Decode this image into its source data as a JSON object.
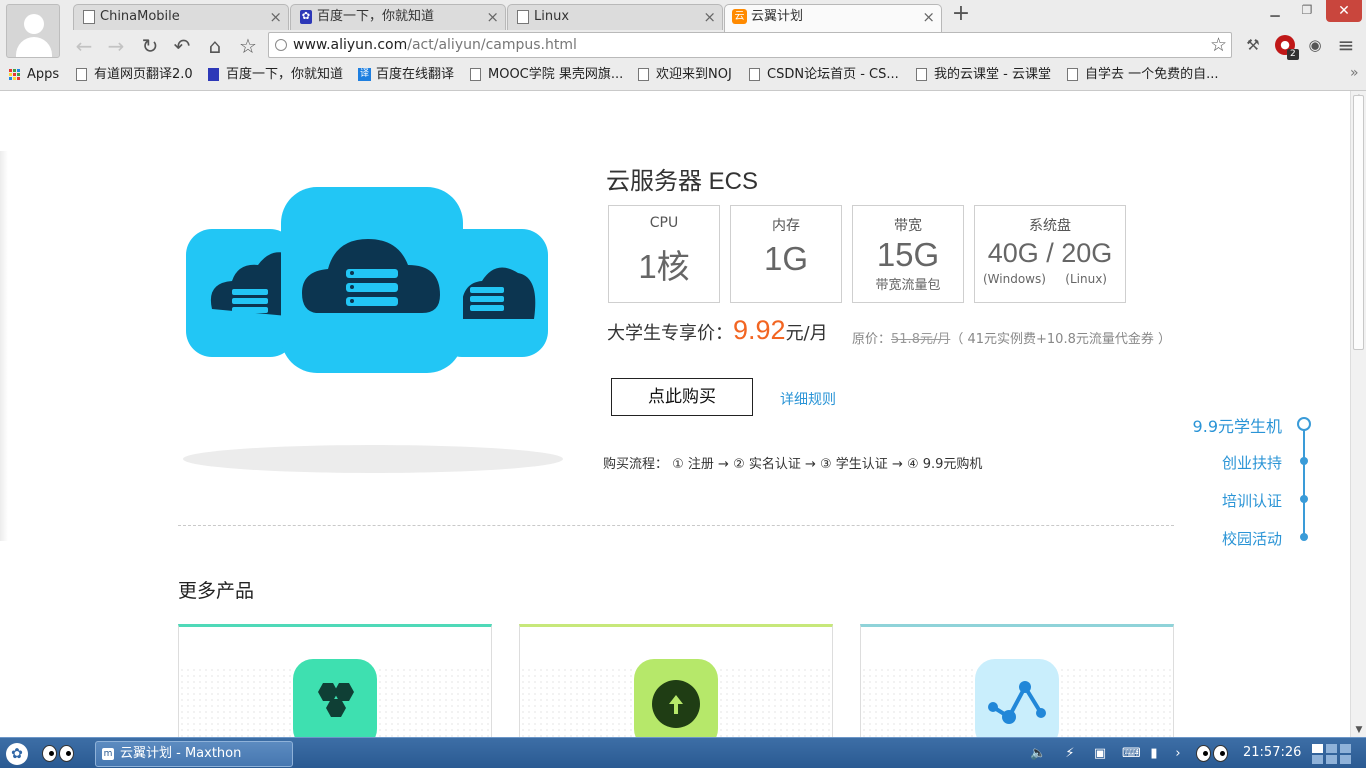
{
  "tabs": [
    {
      "title": "ChinaMobile",
      "icon": "doc-icon"
    },
    {
      "title": "百度一下，你就知道",
      "icon": "baidu-paw-icon"
    },
    {
      "title": "Linux",
      "icon": "doc-icon"
    },
    {
      "title": "云翼计划",
      "icon": "aliyun-icon"
    }
  ],
  "address": {
    "host": "www.aliyun.com",
    "path": "/act/aliyun/campus.html"
  },
  "bookmarks": [
    {
      "label": "Apps"
    },
    {
      "label": "有道网页翻译2.0"
    },
    {
      "label": "百度一下，你就知道"
    },
    {
      "label": "百度在线翻译"
    },
    {
      "label": "MOOC学院 果壳网旗..."
    },
    {
      "label": "欢迎来到NOJ"
    },
    {
      "label": "CSDN论坛首页 - CS..."
    },
    {
      "label": "我的云课堂 - 云课堂"
    },
    {
      "label": "自学去 一个免费的自..."
    }
  ],
  "extension_badge": "2",
  "product": {
    "title": "云服务器 ECS",
    "specs": [
      {
        "label": "CPU",
        "value": "1核"
      },
      {
        "label": "内存",
        "value": "1G"
      },
      {
        "label": "带宽",
        "value": "15G",
        "sub": "带宽流量包"
      },
      {
        "label": "系统盘",
        "value": "40G / 20G",
        "sub_left": "(Windows)",
        "sub_right": "(Linux)"
      }
    ],
    "price_prefix": "大学生专享价：",
    "price": "9.92",
    "price_unit": "元/月",
    "orig_label": "原价：",
    "orig_price": "51.8元/月",
    "orig_detail": "（ 41元实例费+10.8元流量代金券 ）",
    "buy_label": "点此购买",
    "rules_label": "详细规则",
    "flow": "购买流程： ① 注册 → ② 实名认证 → ③ 学生认证 → ④ 9.9元购机"
  },
  "sidenav": [
    {
      "label": "9.9元学生机",
      "active": true
    },
    {
      "label": "创业扶持"
    },
    {
      "label": "培训认证"
    },
    {
      "label": "校园活动"
    }
  ],
  "more_title": "更多产品",
  "cards": [
    {
      "accent": "#4fd9b8",
      "badge": "#3ee0b0",
      "icon": "hexagon-cluster-icon"
    },
    {
      "accent": "#c7e87a",
      "badge": "#b6e86a",
      "icon": "cloud-upload-icon"
    },
    {
      "accent": "#8fd3d9",
      "badge": "#c9eefc",
      "icon": "analytics-graph-icon"
    }
  ],
  "taskbar": {
    "task_label": "云翼计划 - Maxthon",
    "clock": "21:57:26"
  },
  "colors": {
    "accent_blue": "#2a94d6",
    "price_orange": "#f26522",
    "cloud_blue": "#22c6f5"
  }
}
